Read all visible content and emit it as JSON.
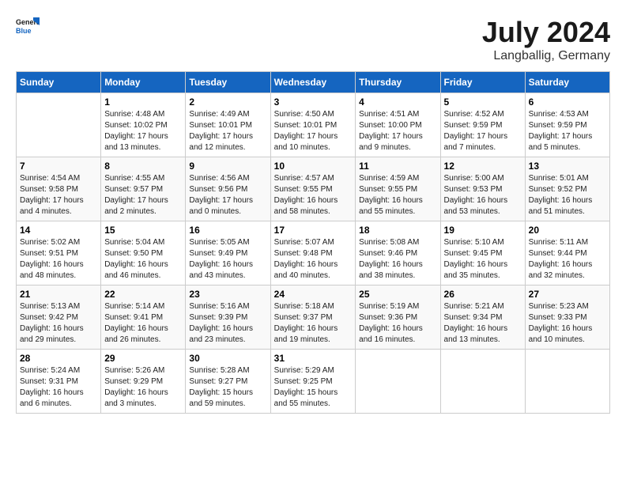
{
  "header": {
    "logo_line1": "General",
    "logo_line2": "Blue",
    "month": "July 2024",
    "location": "Langballig, Germany"
  },
  "weekdays": [
    "Sunday",
    "Monday",
    "Tuesday",
    "Wednesday",
    "Thursday",
    "Friday",
    "Saturday"
  ],
  "weeks": [
    [
      {
        "day": "",
        "info": ""
      },
      {
        "day": "1",
        "info": "Sunrise: 4:48 AM\nSunset: 10:02 PM\nDaylight: 17 hours\nand 13 minutes."
      },
      {
        "day": "2",
        "info": "Sunrise: 4:49 AM\nSunset: 10:01 PM\nDaylight: 17 hours\nand 12 minutes."
      },
      {
        "day": "3",
        "info": "Sunrise: 4:50 AM\nSunset: 10:01 PM\nDaylight: 17 hours\nand 10 minutes."
      },
      {
        "day": "4",
        "info": "Sunrise: 4:51 AM\nSunset: 10:00 PM\nDaylight: 17 hours\nand 9 minutes."
      },
      {
        "day": "5",
        "info": "Sunrise: 4:52 AM\nSunset: 9:59 PM\nDaylight: 17 hours\nand 7 minutes."
      },
      {
        "day": "6",
        "info": "Sunrise: 4:53 AM\nSunset: 9:59 PM\nDaylight: 17 hours\nand 5 minutes."
      }
    ],
    [
      {
        "day": "7",
        "info": "Sunrise: 4:54 AM\nSunset: 9:58 PM\nDaylight: 17 hours\nand 4 minutes."
      },
      {
        "day": "8",
        "info": "Sunrise: 4:55 AM\nSunset: 9:57 PM\nDaylight: 17 hours\nand 2 minutes."
      },
      {
        "day": "9",
        "info": "Sunrise: 4:56 AM\nSunset: 9:56 PM\nDaylight: 17 hours\nand 0 minutes."
      },
      {
        "day": "10",
        "info": "Sunrise: 4:57 AM\nSunset: 9:55 PM\nDaylight: 16 hours\nand 58 minutes."
      },
      {
        "day": "11",
        "info": "Sunrise: 4:59 AM\nSunset: 9:55 PM\nDaylight: 16 hours\nand 55 minutes."
      },
      {
        "day": "12",
        "info": "Sunrise: 5:00 AM\nSunset: 9:53 PM\nDaylight: 16 hours\nand 53 minutes."
      },
      {
        "day": "13",
        "info": "Sunrise: 5:01 AM\nSunset: 9:52 PM\nDaylight: 16 hours\nand 51 minutes."
      }
    ],
    [
      {
        "day": "14",
        "info": "Sunrise: 5:02 AM\nSunset: 9:51 PM\nDaylight: 16 hours\nand 48 minutes."
      },
      {
        "day": "15",
        "info": "Sunrise: 5:04 AM\nSunset: 9:50 PM\nDaylight: 16 hours\nand 46 minutes."
      },
      {
        "day": "16",
        "info": "Sunrise: 5:05 AM\nSunset: 9:49 PM\nDaylight: 16 hours\nand 43 minutes."
      },
      {
        "day": "17",
        "info": "Sunrise: 5:07 AM\nSunset: 9:48 PM\nDaylight: 16 hours\nand 40 minutes."
      },
      {
        "day": "18",
        "info": "Sunrise: 5:08 AM\nSunset: 9:46 PM\nDaylight: 16 hours\nand 38 minutes."
      },
      {
        "day": "19",
        "info": "Sunrise: 5:10 AM\nSunset: 9:45 PM\nDaylight: 16 hours\nand 35 minutes."
      },
      {
        "day": "20",
        "info": "Sunrise: 5:11 AM\nSunset: 9:44 PM\nDaylight: 16 hours\nand 32 minutes."
      }
    ],
    [
      {
        "day": "21",
        "info": "Sunrise: 5:13 AM\nSunset: 9:42 PM\nDaylight: 16 hours\nand 29 minutes."
      },
      {
        "day": "22",
        "info": "Sunrise: 5:14 AM\nSunset: 9:41 PM\nDaylight: 16 hours\nand 26 minutes."
      },
      {
        "day": "23",
        "info": "Sunrise: 5:16 AM\nSunset: 9:39 PM\nDaylight: 16 hours\nand 23 minutes."
      },
      {
        "day": "24",
        "info": "Sunrise: 5:18 AM\nSunset: 9:37 PM\nDaylight: 16 hours\nand 19 minutes."
      },
      {
        "day": "25",
        "info": "Sunrise: 5:19 AM\nSunset: 9:36 PM\nDaylight: 16 hours\nand 16 minutes."
      },
      {
        "day": "26",
        "info": "Sunrise: 5:21 AM\nSunset: 9:34 PM\nDaylight: 16 hours\nand 13 minutes."
      },
      {
        "day": "27",
        "info": "Sunrise: 5:23 AM\nSunset: 9:33 PM\nDaylight: 16 hours\nand 10 minutes."
      }
    ],
    [
      {
        "day": "28",
        "info": "Sunrise: 5:24 AM\nSunset: 9:31 PM\nDaylight: 16 hours\nand 6 minutes."
      },
      {
        "day": "29",
        "info": "Sunrise: 5:26 AM\nSunset: 9:29 PM\nDaylight: 16 hours\nand 3 minutes."
      },
      {
        "day": "30",
        "info": "Sunrise: 5:28 AM\nSunset: 9:27 PM\nDaylight: 15 hours\nand 59 minutes."
      },
      {
        "day": "31",
        "info": "Sunrise: 5:29 AM\nSunset: 9:25 PM\nDaylight: 15 hours\nand 55 minutes."
      },
      {
        "day": "",
        "info": ""
      },
      {
        "day": "",
        "info": ""
      },
      {
        "day": "",
        "info": ""
      }
    ]
  ]
}
